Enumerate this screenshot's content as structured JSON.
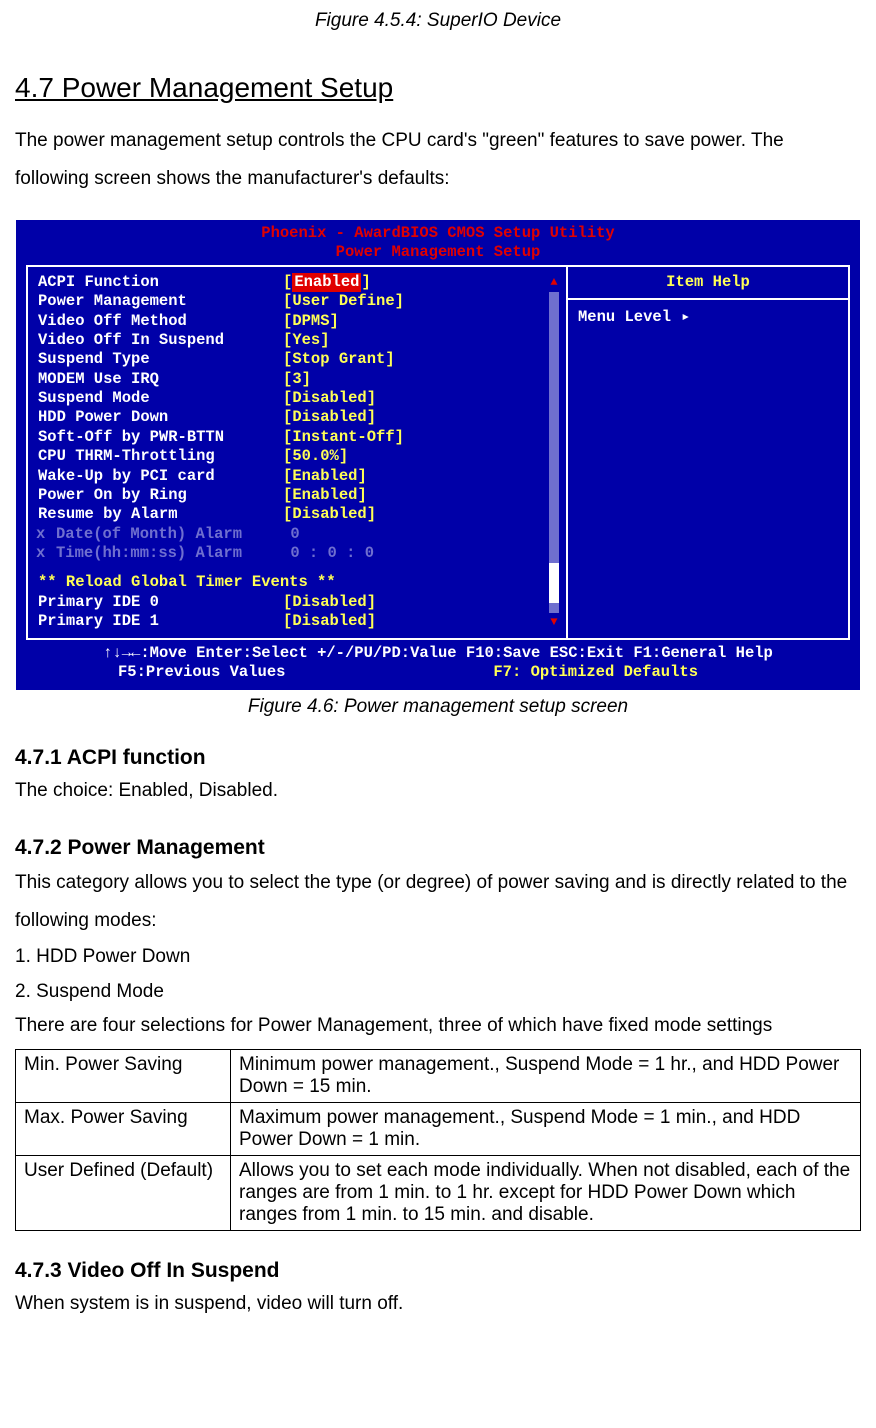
{
  "figCaptionTop": "Figure 4.5.4: SuperIO Device",
  "section": {
    "title": "4.7 Power Management Setup",
    "intro": "The power management setup controls the CPU card's \"green\" features to save power. The following screen shows the manufacturer's defaults:"
  },
  "bios": {
    "title1": "Phoenix - AwardBIOS CMOS Setup Utility",
    "title2": "Power Management Setup",
    "itemHelp": "Item Help",
    "menuLevel": "Menu Level",
    "rows": [
      {
        "label": "ACPI Function",
        "value": "Enabled",
        "selected": true
      },
      {
        "label": "Power Management",
        "value": "User Define"
      },
      {
        "label": "Video Off Method",
        "value": "DPMS"
      },
      {
        "label": "Video Off In Suspend",
        "value": "Yes"
      },
      {
        "label": "Suspend Type",
        "value": "Stop Grant"
      },
      {
        "label": "MODEM Use IRQ",
        "value": "3"
      },
      {
        "label": "Suspend Mode",
        "value": "Disabled"
      },
      {
        "label": "HDD Power Down",
        "value": "Disabled"
      },
      {
        "label": "Soft-Off by PWR-BTTN",
        "value": "Instant-Off"
      },
      {
        "label": "CPU THRM-Throttling",
        "value": "50.0%"
      },
      {
        "label": "Wake-Up by PCI card",
        "value": "Enabled"
      },
      {
        "label": "Power On by Ring",
        "value": "Enabled"
      },
      {
        "label": "Resume by Alarm",
        "value": "Disabled"
      }
    ],
    "mutedRows": [
      {
        "mark": "x",
        "label": "Date(of Month) Alarm",
        "value": "0"
      },
      {
        "mark": "x",
        "label": "Time(hh:mm:ss) Alarm",
        "value": "0 :  0 :  0"
      }
    ],
    "sectionHeader": "** Reload Global Timer Events **",
    "bottomRows": [
      {
        "label": "Primary IDE 0",
        "value": "Disabled"
      },
      {
        "label": "Primary IDE 1",
        "value": "Disabled"
      }
    ],
    "footerLine1": "↑↓→←:Move  Enter:Select  +/-/PU/PD:Value  F10:Save  ESC:Exit  F1:General Help",
    "footerLeft": "F5:Previous Values",
    "footerRight": "F7: Optimized Defaults"
  },
  "figCaption": "Figure 4.6: Power management setup screen",
  "sub1": {
    "heading": "4.7.1 ACPI function",
    "text": "The choice: Enabled, Disabled."
  },
  "sub2": {
    "heading": "4.7.2 Power Management",
    "text1": "This category allows you to select the type (or degree) of power saving and is directly related to the following modes:",
    "li1": "1. HDD Power Down",
    "li2": "2. Suspend Mode",
    "text2": "There are four selections for Power Management, three of which have fixed mode settings",
    "tableRows": [
      {
        "c1": "Min. Power Saving",
        "c2": "Minimum power management., Suspend Mode = 1 hr., and HDD Power Down = 15 min."
      },
      {
        "c1": "Max. Power Saving",
        "c2": "Maximum power management., Suspend Mode = 1 min., and HDD Power Down = 1 min."
      },
      {
        "c1": "User Defined (Default)",
        "c2": "Allows you to set each mode individually. When not disabled, each of the ranges are from 1 min. to 1 hr. except for HDD Power Down which ranges from 1 min. to 15 min. and disable."
      }
    ]
  },
  "sub3": {
    "heading": "4.7.3 Video Off In Suspend",
    "text": "When system is in suspend, video will turn off."
  }
}
